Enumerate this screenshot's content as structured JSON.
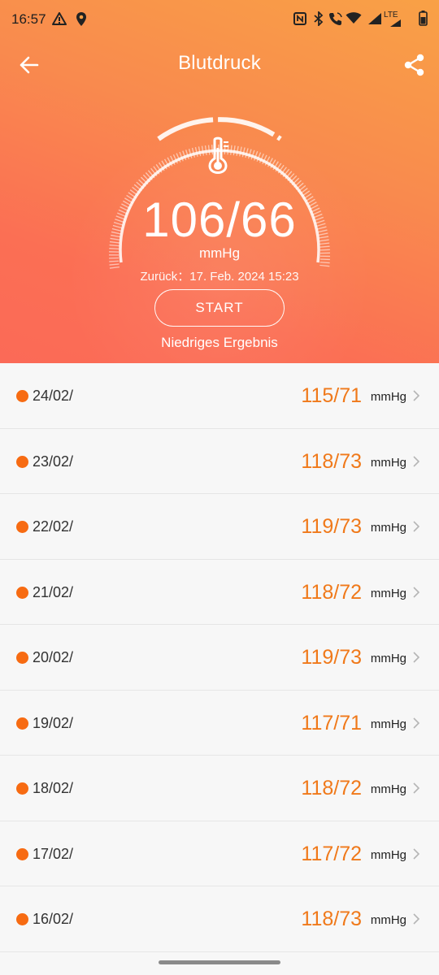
{
  "status_bar": {
    "time": "16:57",
    "network_label": "LTE",
    "icons": [
      "warning-icon",
      "location-pin-icon",
      "nfc-icon",
      "bluetooth-icon",
      "wifi-calling-icon",
      "wifi-icon",
      "signal-icon",
      "battery-icon"
    ]
  },
  "header": {
    "title": "Blutdruck",
    "back_icon": "arrow-left-icon",
    "share_icon": "share-icon"
  },
  "measurement": {
    "reading": "106/66",
    "unit": "mmHg",
    "last_measured": "Zurück：17. Feb. 2024 15:23",
    "start_label": "START",
    "result_label": "Niedriges Ergebnis"
  },
  "colors": {
    "accent_orange": "#f0791a",
    "dot_orange": "#f76b12",
    "hero_top": "#f9a146",
    "hero_bottom": "#fb6a57"
  },
  "history": [
    {
      "date": "24/02/",
      "value": "115/71",
      "unit": "mmHg"
    },
    {
      "date": "23/02/",
      "value": "118/73",
      "unit": "mmHg"
    },
    {
      "date": "22/02/",
      "value": "119/73",
      "unit": "mmHg"
    },
    {
      "date": "21/02/",
      "value": "118/72",
      "unit": "mmHg"
    },
    {
      "date": "20/02/",
      "value": "119/73",
      "unit": "mmHg"
    },
    {
      "date": "19/02/",
      "value": "117/71",
      "unit": "mmHg"
    },
    {
      "date": "18/02/",
      "value": "118/72",
      "unit": "mmHg"
    },
    {
      "date": "17/02/",
      "value": "117/72",
      "unit": "mmHg"
    },
    {
      "date": "16/02/",
      "value": "118/73",
      "unit": "mmHg"
    }
  ]
}
